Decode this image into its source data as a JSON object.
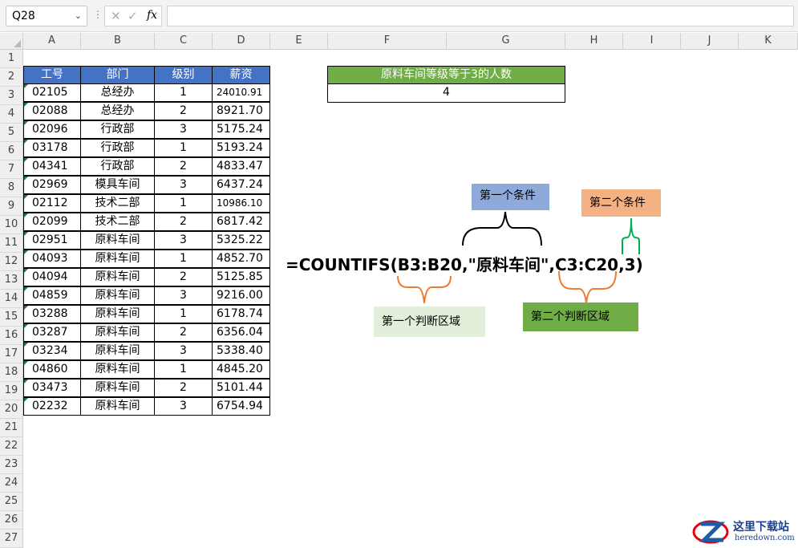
{
  "formula_bar": {
    "name_box": "Q28",
    "formula": "",
    "fx_label": "fx"
  },
  "columns": [
    "A",
    "B",
    "C",
    "D",
    "E",
    "F",
    "G",
    "H",
    "I",
    "J",
    "K"
  ],
  "rows": [
    "1",
    "2",
    "3",
    "4",
    "5",
    "6",
    "7",
    "8",
    "9",
    "10",
    "11",
    "12",
    "13",
    "14",
    "15",
    "16",
    "17",
    "18",
    "19",
    "20",
    "21",
    "22",
    "23",
    "24",
    "25",
    "26",
    "27"
  ],
  "table": {
    "headers": [
      "工号",
      "部门",
      "级别",
      "薪资"
    ],
    "rows": [
      [
        "02105",
        "总经办",
        "1",
        "24010.91"
      ],
      [
        "02088",
        "总经办",
        "2",
        "8921.70"
      ],
      [
        "02096",
        "行政部",
        "3",
        "5175.24"
      ],
      [
        "03178",
        "行政部",
        "1",
        "5193.24"
      ],
      [
        "04341",
        "行政部",
        "2",
        "4833.47"
      ],
      [
        "02969",
        "模具车间",
        "3",
        "6437.24"
      ],
      [
        "02112",
        "技术二部",
        "1",
        "10986.10"
      ],
      [
        "02099",
        "技术二部",
        "2",
        "6817.42"
      ],
      [
        "02951",
        "原料车间",
        "3",
        "5325.22"
      ],
      [
        "04093",
        "原料车间",
        "1",
        "4852.70"
      ],
      [
        "04094",
        "原料车间",
        "2",
        "5125.85"
      ],
      [
        "04859",
        "原料车间",
        "3",
        "9216.00"
      ],
      [
        "03288",
        "原料车间",
        "1",
        "6178.74"
      ],
      [
        "03287",
        "原料车间",
        "2",
        "6356.04"
      ],
      [
        "03234",
        "原料车间",
        "3",
        "5338.40"
      ],
      [
        "04860",
        "原料车间",
        "1",
        "4845.20"
      ],
      [
        "03473",
        "原料车间",
        "2",
        "5101.44"
      ],
      [
        "02232",
        "原料车间",
        "3",
        "6754.94"
      ]
    ]
  },
  "summary": {
    "title": "原料车间等级等于3的人数",
    "value": "4"
  },
  "annotation": {
    "formula": "=COUNTIFS(B3:B20,\"原料车间\",C3:C20,3)",
    "labels": {
      "cond1": "第一个条件",
      "cond2": "第二个条件",
      "range1": "第一个判断区域",
      "range2": "第二个判断区域"
    },
    "colors": {
      "header_blue": "#4472c4",
      "summary_green": "#70ad47",
      "cond1_bg": "#8eaadb",
      "cond2_bg": "#f4b183",
      "range1_bg": "#e2efda",
      "range2_bg": "#70ad47",
      "brace_orange": "#ed7d31",
      "brace_green": "#00b050"
    }
  },
  "watermark": {
    "brand": "这里下载站",
    "url": "heredown.com",
    "icon": "z-logo-icon"
  }
}
